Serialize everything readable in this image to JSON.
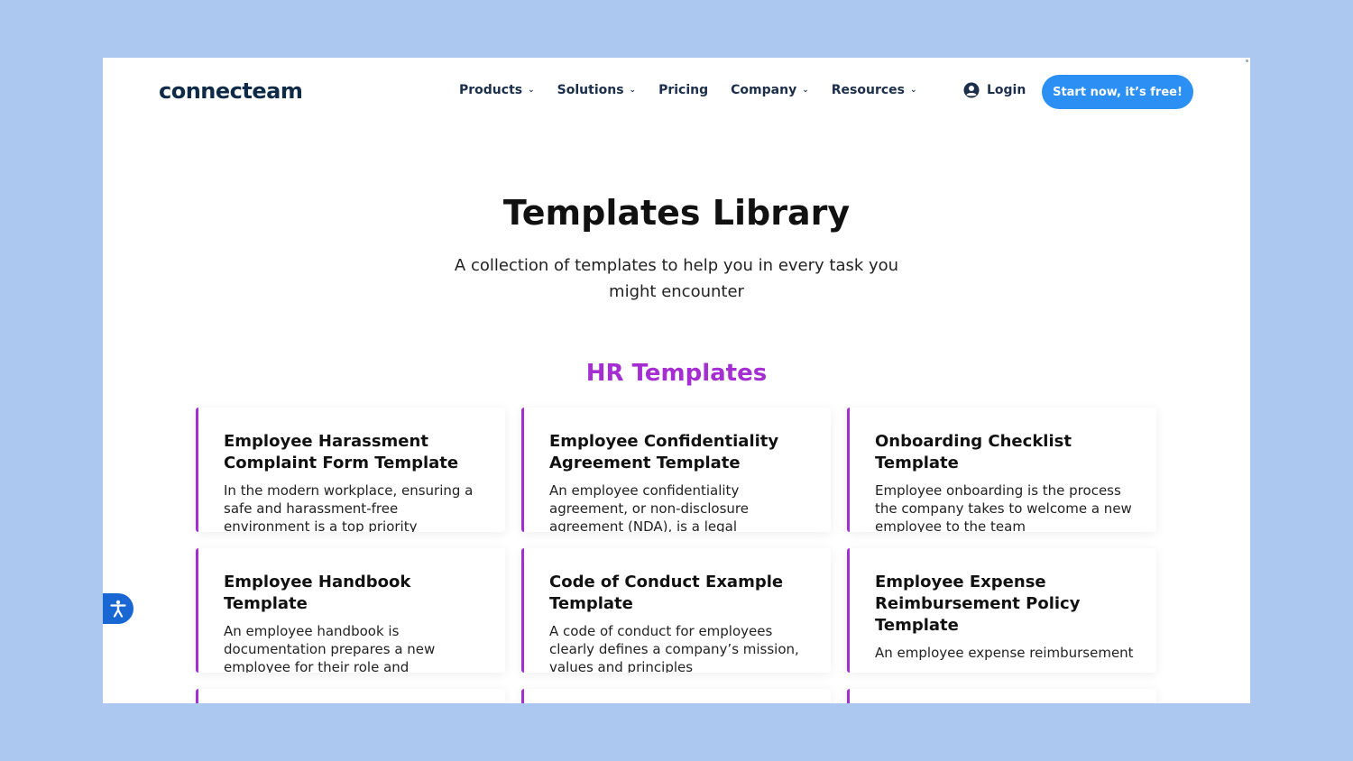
{
  "header": {
    "logo": "connecteam",
    "nav": [
      {
        "label": "Products",
        "dropdown": true
      },
      {
        "label": "Solutions",
        "dropdown": true
      },
      {
        "label": "Pricing",
        "dropdown": false
      },
      {
        "label": "Company",
        "dropdown": true
      },
      {
        "label": "Resources",
        "dropdown": true
      }
    ],
    "login_label": "Login",
    "cta_label": "Start now, it’s free!"
  },
  "hero": {
    "title": "Templates Library",
    "subtitle": "A collection of templates to help you in every task you might encounter"
  },
  "section": {
    "title": "HR Templates",
    "accent_color": "#a42ed1",
    "cards": [
      {
        "title": "Employee Harassment Complaint Form Template",
        "desc": "In the modern workplace, ensuring a safe and harassment-free environment is a top priority"
      },
      {
        "title": "Employee Confidentiality Agreement Template",
        "desc": "An employee confidentiality agreement, or non-disclosure agreement (NDA), is a legal"
      },
      {
        "title": "Onboarding Checklist Template",
        "desc": "Employee onboarding is the process the company takes to welcome a new employee to the team"
      },
      {
        "title": "Employee Handbook Template",
        "desc": "An employee handbook is documentation prepares a new employee for their role and"
      },
      {
        "title": "Code of Conduct Example Template",
        "desc": "A code of conduct for employees clearly defines a company’s mission, values and principles"
      },
      {
        "title": "Employee Expense Reimbursement Policy Template",
        "desc": "An employee expense reimbursement"
      }
    ]
  },
  "colors": {
    "cta": "#2b8ff3",
    "page_bg": "#adc8f0",
    "accessibility": "#1967d2"
  },
  "icons": {
    "login": "user-circle-icon",
    "accessibility": "accessibility-icon",
    "dropdown": "chevron-down-icon"
  }
}
